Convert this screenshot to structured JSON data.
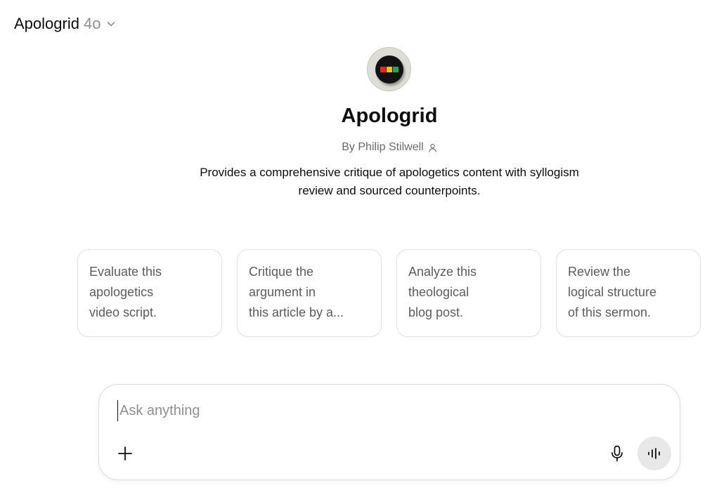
{
  "header": {
    "model_name": "Apologrid",
    "model_version": "4o",
    "chevron_icon": "chevron-down-icon"
  },
  "gpt": {
    "avatar_icon": "traffic-light-logo",
    "avatar_colors": [
      "#e8262a",
      "#f4c20d",
      "#1fa84f"
    ],
    "title": "Apologrid",
    "author": "By Philip Stilwell",
    "author_icon": "person-icon",
    "description": "Provides a comprehensive critique of apologetics content with syllogism review and sourced counterpoints."
  },
  "starters": [
    {
      "lines": [
        "Evaluate this",
        "apologetics",
        "video script."
      ]
    },
    {
      "lines": [
        "Critique the",
        "argument in",
        "this article by a..."
      ]
    },
    {
      "lines": [
        "Analyze this",
        "theological",
        "blog post."
      ]
    },
    {
      "lines": [
        "Review the",
        "logical structure",
        "of this sermon."
      ]
    }
  ],
  "composer": {
    "placeholder": "Ask anything",
    "value": "",
    "attach_icon": "plus-icon",
    "mic_icon": "microphone-icon",
    "voice_icon": "voice-mode-icon"
  }
}
